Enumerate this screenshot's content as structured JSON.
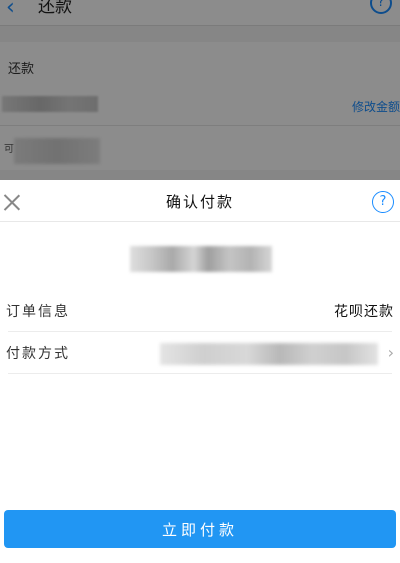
{
  "background": {
    "header": {
      "back_icon": "chevron-left-icon",
      "title": "还款",
      "help_icon": "question-circle-icon"
    },
    "section_title": "还款",
    "modify_link": "修改金额",
    "note_prefix": "可"
  },
  "sheet": {
    "title": "确认付款",
    "close_icon": "close-icon",
    "help_icon": "question-circle-icon",
    "rows": [
      {
        "label": "订单信息",
        "value": "花呗还款"
      },
      {
        "label": "付款方式",
        "value": ""
      }
    ],
    "pay_button": "立即付款"
  },
  "colors": {
    "accent": "#2196f3",
    "link": "#1a8cff",
    "overlay": "rgba(0,0,0,0.45)"
  }
}
